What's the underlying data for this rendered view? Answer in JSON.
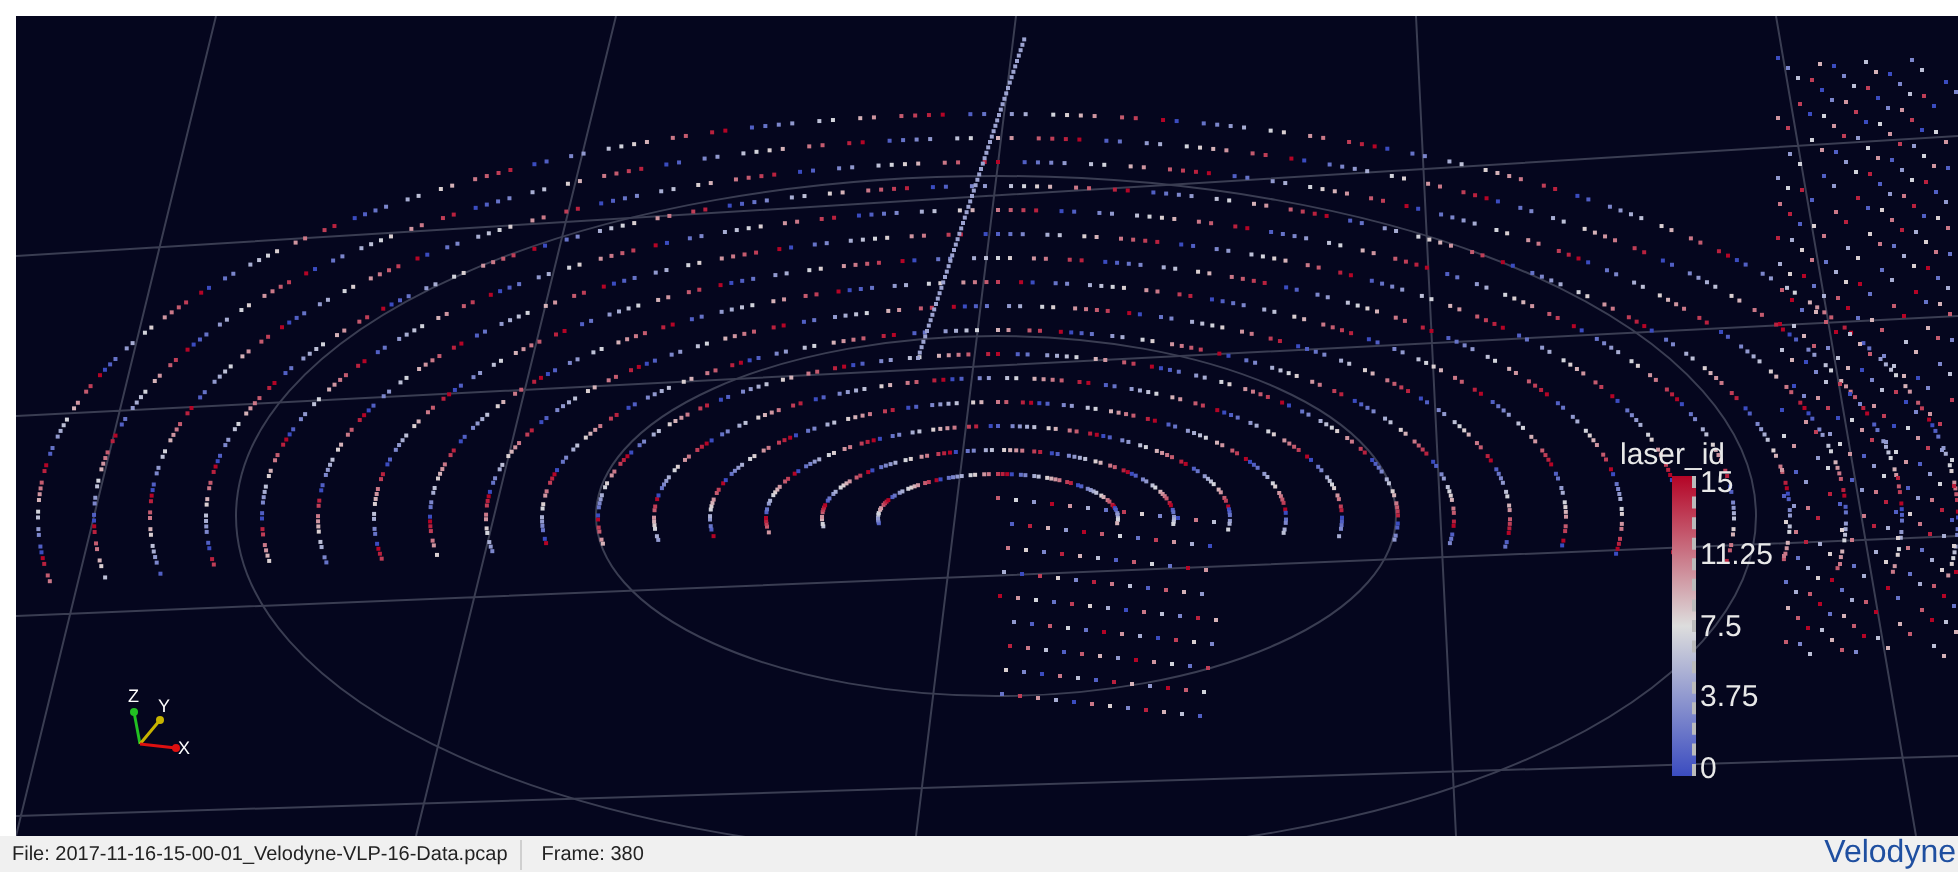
{
  "viewport": {
    "axes": {
      "x": "X",
      "y": "Y",
      "z": "Z"
    },
    "legend": {
      "title": "laser_id",
      "ticks": [
        "15",
        "11.25",
        "7.5",
        "3.75",
        "0"
      ]
    }
  },
  "status_bar": {
    "file": "File: 2017-11-16-15-00-01_Velodyne-VLP-16-Data.pcap",
    "frame": "Frame: 380",
    "logo": "Velodyne"
  }
}
